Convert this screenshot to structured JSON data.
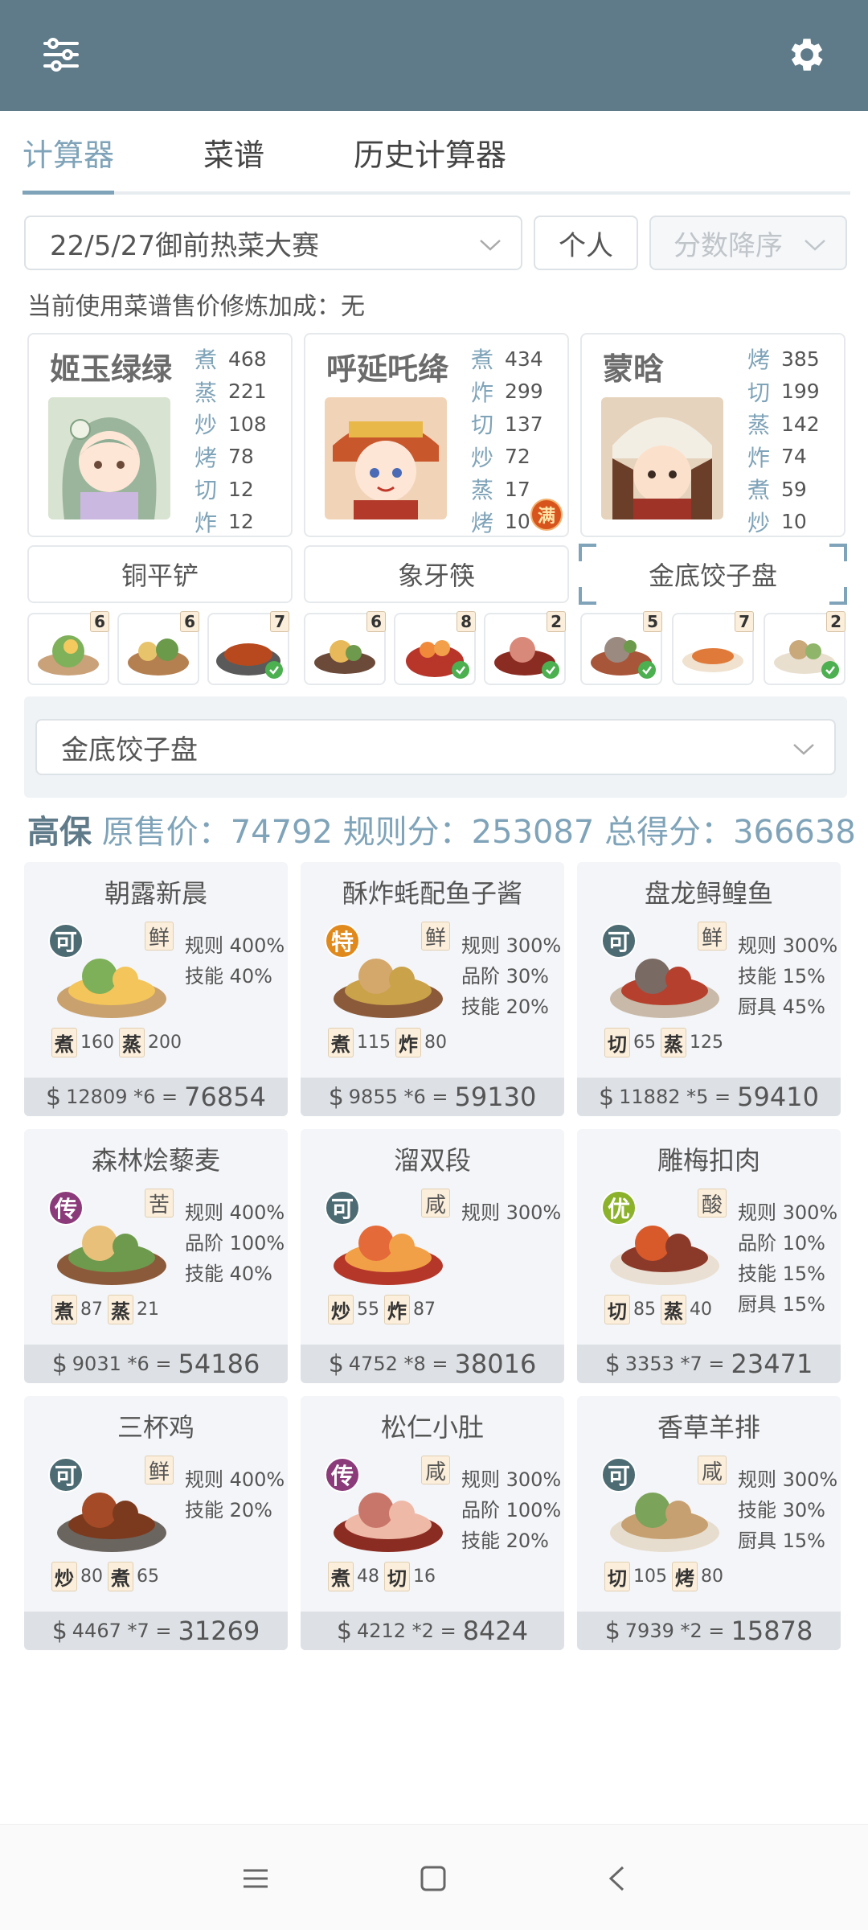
{
  "topbar": {
    "left_icon": "sliders-icon",
    "right_icon": "gear-icon",
    "bg_color": "#5f7a89"
  },
  "tabs": [
    {
      "label": "计算器",
      "active": true
    },
    {
      "label": "菜谱",
      "active": false
    },
    {
      "label": "历史计算器",
      "active": false
    }
  ],
  "filters": {
    "contest": "22/5/27御前热菜大赛",
    "mode": "个人",
    "sort_placeholder": "分数降序"
  },
  "bonus_text": "当前使用菜谱售价修炼加成：无",
  "chefs": [
    {
      "name": "姬玉绿绿",
      "stats": [
        {
          "k": "煮",
          "v": "468"
        },
        {
          "k": "蒸",
          "v": "221"
        },
        {
          "k": "炒",
          "v": "108"
        },
        {
          "k": "烤",
          "v": "78"
        },
        {
          "k": "切",
          "v": "12"
        },
        {
          "k": "炸",
          "v": "12"
        }
      ]
    },
    {
      "name": "呼延吒绛",
      "badge": "满",
      "stats": [
        {
          "k": "煮",
          "v": "434"
        },
        {
          "k": "炸",
          "v": "299"
        },
        {
          "k": "切",
          "v": "137"
        },
        {
          "k": "炒",
          "v": "72"
        },
        {
          "k": "蒸",
          "v": "17"
        },
        {
          "k": "烤",
          "v": "10"
        }
      ]
    },
    {
      "name": "蒙晗",
      "stats": [
        {
          "k": "烤",
          "v": "385"
        },
        {
          "k": "切",
          "v": "199"
        },
        {
          "k": "蒸",
          "v": "142"
        },
        {
          "k": "炸",
          "v": "74"
        },
        {
          "k": "煮",
          "v": "59"
        },
        {
          "k": "炒",
          "v": "10"
        }
      ]
    }
  ],
  "equipment": [
    "铜平铲",
    "象牙筷",
    "金底饺子盘"
  ],
  "dish_thumbs": [
    {
      "count": "6",
      "check": false
    },
    {
      "count": "6",
      "check": false
    },
    {
      "count": "7",
      "check": true
    },
    {
      "count": "6",
      "check": false
    },
    {
      "count": "8",
      "check": true
    },
    {
      "count": "2",
      "check": true
    },
    {
      "count": "5",
      "check": true
    },
    {
      "count": "7",
      "check": false
    },
    {
      "count": "2",
      "check": true
    }
  ],
  "selected_equipment": "金底饺子盘",
  "score": {
    "label": "高保",
    "text": " 原售价：74792 规则分：253087 总得分：366638"
  },
  "recipes": [
    {
      "name": "朝露新晨",
      "rarity": "可",
      "flavor": "鲜",
      "bonuses": [
        "规则 400%",
        "技能 40%"
      ],
      "skills": [
        {
          "k": "煮",
          "v": "160"
        },
        {
          "k": "蒸",
          "v": "200"
        }
      ],
      "price": "12809 *6",
      "total": "76854"
    },
    {
      "name": "酥炸蚝配鱼子酱",
      "rarity": "特",
      "flavor": "鲜",
      "bonuses": [
        "规则 300%",
        "品阶 30%",
        "技能 20%"
      ],
      "skills": [
        {
          "k": "煮",
          "v": "115"
        },
        {
          "k": "炸",
          "v": "80"
        }
      ],
      "price": "9855 *6",
      "total": "59130"
    },
    {
      "name": "盘龙鲟鳇鱼",
      "rarity": "可",
      "flavor": "鲜",
      "bonuses": [
        "规则 300%",
        "技能 15%",
        "厨具 45%"
      ],
      "skills": [
        {
          "k": "切",
          "v": "65"
        },
        {
          "k": "蒸",
          "v": "125"
        }
      ],
      "price": "11882 *5",
      "total": "59410"
    },
    {
      "name": "森林烩藜麦",
      "rarity": "传",
      "flavor": "苦",
      "bonuses": [
        "规则 400%",
        "品阶 100%",
        "技能 40%"
      ],
      "skills": [
        {
          "k": "煮",
          "v": "87"
        },
        {
          "k": "蒸",
          "v": "21"
        }
      ],
      "price": "9031 *6",
      "total": "54186"
    },
    {
      "name": "溜双段",
      "rarity": "可",
      "flavor": "咸",
      "bonuses": [
        "规则 300%"
      ],
      "skills": [
        {
          "k": "炒",
          "v": "55"
        },
        {
          "k": "炸",
          "v": "87"
        }
      ],
      "price": "4752 *8",
      "total": "38016"
    },
    {
      "name": "雕梅扣肉",
      "rarity": "优",
      "flavor": "酸",
      "bonuses": [
        "规则 300%",
        "品阶 10%",
        "技能 15%",
        "厨具 15%"
      ],
      "skills": [
        {
          "k": "切",
          "v": "85"
        },
        {
          "k": "蒸",
          "v": "40"
        }
      ],
      "price": "3353 *7",
      "total": "23471"
    },
    {
      "name": "三杯鸡",
      "rarity": "可",
      "flavor": "鲜",
      "bonuses": [
        "规则 400%",
        "技能 20%"
      ],
      "skills": [
        {
          "k": "炒",
          "v": "80"
        },
        {
          "k": "煮",
          "v": "65"
        }
      ],
      "price": "4467 *7",
      "total": "31269"
    },
    {
      "name": "松仁小肚",
      "rarity": "传",
      "flavor": "咸",
      "bonuses": [
        "规则 300%",
        "品阶 100%",
        "技能 20%"
      ],
      "skills": [
        {
          "k": "煮",
          "v": "48"
        },
        {
          "k": "切",
          "v": "16"
        }
      ],
      "price": "4212 *2",
      "total": "8424"
    },
    {
      "name": "香草羊排",
      "rarity": "可",
      "flavor": "咸",
      "bonuses": [
        "规则 300%",
        "技能 30%",
        "厨具 15%"
      ],
      "skills": [
        {
          "k": "切",
          "v": "105"
        },
        {
          "k": "烤",
          "v": "80"
        }
      ],
      "price": "7939 *2",
      "total": "15878"
    }
  ],
  "navbar": {
    "icons": [
      "menu-icon",
      "home-icon",
      "back-icon"
    ]
  },
  "colors": {
    "accent": "#7fa3b8",
    "rarity_ke": "#4d6b73",
    "rarity_te": "#e08a1e",
    "rarity_chuan": "#8b3b7a",
    "rarity_you": "#8bb22a"
  }
}
